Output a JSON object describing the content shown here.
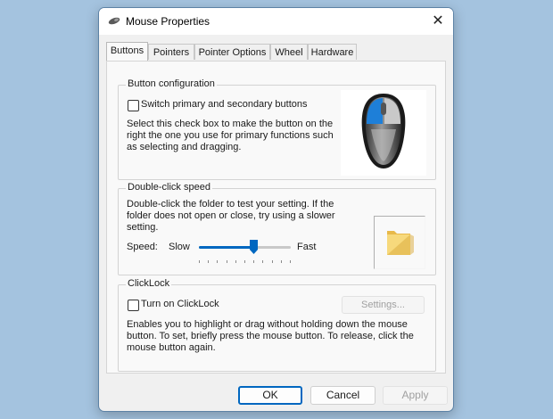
{
  "window": {
    "title": "Mouse Properties",
    "close_glyph": "✕"
  },
  "tabs": [
    {
      "label": "Buttons",
      "active": true
    },
    {
      "label": "Pointers",
      "active": false
    },
    {
      "label": "Pointer Options",
      "active": false
    },
    {
      "label": "Wheel",
      "active": false
    },
    {
      "label": "Hardware",
      "active": false
    }
  ],
  "button_config": {
    "title": "Button configuration",
    "checkbox_label": "Switch primary and secondary buttons",
    "checked": false,
    "description": "Select this check box to make the button on the right the one you use for primary functions such as selecting and dragging."
  },
  "double_click": {
    "title": "Double-click speed",
    "description": "Double-click the folder to test your setting. If the folder does not open or close, try using a slower setting.",
    "speed_label": "Speed:",
    "slow_label": "Slow",
    "fast_label": "Fast",
    "slider_value_fraction": 0.6
  },
  "click_lock": {
    "title": "ClickLock",
    "checkbox_label": "Turn on ClickLock",
    "checked": false,
    "settings_label": "Settings...",
    "settings_enabled": false,
    "description": "Enables you to highlight or drag without holding down the mouse button. To set, briefly press the mouse button. To release, click the mouse button again."
  },
  "footer": {
    "ok_label": "OK",
    "cancel_label": "Cancel",
    "apply_label": "Apply",
    "apply_enabled": false
  },
  "colors": {
    "accent": "#0067c0",
    "desktop": "#a4c3df",
    "mouse_primary_button": "#1e7fd8"
  }
}
